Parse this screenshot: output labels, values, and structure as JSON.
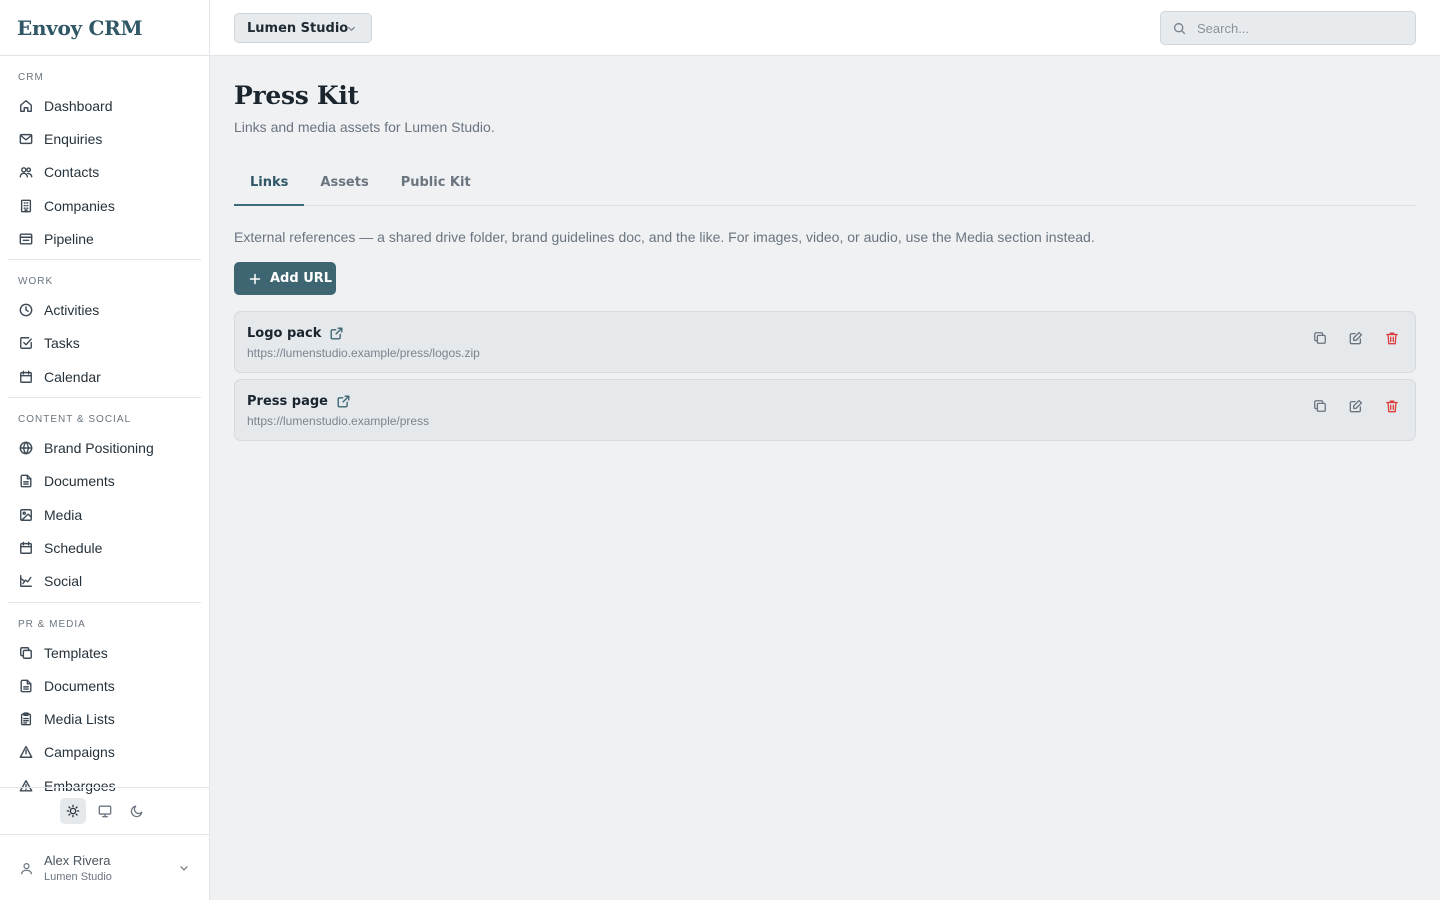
{
  "brand": {
    "name": "Envoy CRM"
  },
  "sidebar": {
    "sections": [
      {
        "title": "CRM",
        "items": [
          {
            "label": "Dashboard",
            "icon": "home-icon"
          },
          {
            "label": "Enquiries",
            "icon": "mail-icon"
          },
          {
            "label": "Contacts",
            "icon": "users-icon"
          },
          {
            "label": "Companies",
            "icon": "building-icon"
          },
          {
            "label": "Pipeline",
            "icon": "pipeline-icon"
          }
        ]
      },
      {
        "title": "WORK",
        "items": [
          {
            "label": "Activities",
            "icon": "clock-icon"
          },
          {
            "label": "Tasks",
            "icon": "check-square-icon"
          },
          {
            "label": "Calendar",
            "icon": "calendar-icon"
          }
        ]
      },
      {
        "title": "CONTENT & SOCIAL",
        "items": [
          {
            "label": "Brand Positioning",
            "icon": "globe-icon"
          },
          {
            "label": "Documents",
            "icon": "document-icon"
          },
          {
            "label": "Media",
            "icon": "image-icon"
          },
          {
            "label": "Schedule",
            "icon": "calendar-icon"
          },
          {
            "label": "Social",
            "icon": "chart-icon"
          }
        ]
      },
      {
        "title": "PR & MEDIA",
        "items": [
          {
            "label": "Templates",
            "icon": "copy-icon"
          },
          {
            "label": "Documents",
            "icon": "document-icon"
          },
          {
            "label": "Media Lists",
            "icon": "clipboard-icon"
          },
          {
            "label": "Campaigns",
            "icon": "triangle-icon"
          },
          {
            "label": "Embargoes",
            "icon": "alert-triangle-icon"
          }
        ]
      }
    ]
  },
  "theme": {
    "active": "light"
  },
  "user": {
    "name": "Alex Rivera",
    "org": "Lumen Studio"
  },
  "topbar": {
    "workspace": "Lumen Studio",
    "search_placeholder": "Search..."
  },
  "page": {
    "title": "Press Kit",
    "subtitle": "Links and media assets for Lumen Studio.",
    "tabs": [
      {
        "label": "Links",
        "active": true
      },
      {
        "label": "Assets",
        "active": false
      },
      {
        "label": "Public Kit",
        "active": false
      }
    ],
    "description": "External references — a shared drive folder, brand guidelines doc, and the like. For images, video, or audio, use the Media section instead.",
    "add_button": "Add URL",
    "links": [
      {
        "title": "Logo pack",
        "url": "https://lumenstudio.example/press/logos.zip"
      },
      {
        "title": "Press page",
        "url": "https://lumenstudio.example/press"
      }
    ]
  },
  "colors": {
    "accent": "#3d6672",
    "brand": "#2f5766",
    "danger": "#dc3b3b"
  }
}
